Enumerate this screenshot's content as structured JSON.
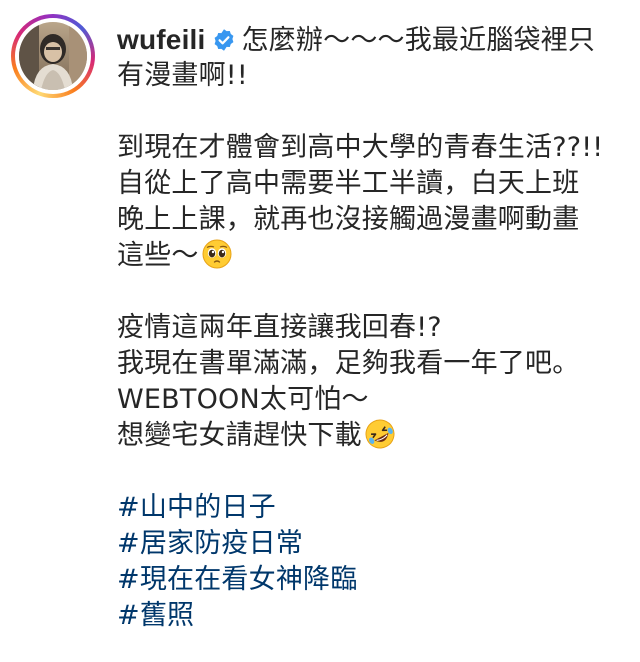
{
  "post": {
    "username": "wufeili",
    "verified_icon": "verified-badge-icon",
    "caption_lines": [
      "怎麼辦～～～我最近腦袋裡只",
      "有漫畫啊!!",
      "",
      "到現在才體會到高中大學的青春生活??!!",
      "自從上了高中需要半工半讀，白天上班",
      "晚上上課，就再也沒接觸過漫畫啊動畫",
      "這些～",
      "",
      "疫情這兩年直接讓我回春!?",
      "我現在書單滿滿，足夠我看一年了吧。",
      "WEBTOON太可怕～",
      "想變宅女請趕快下載",
      ""
    ],
    "emojis": {
      "pleading": "pleading-face-icon",
      "rofl": "rolling-on-floor-laughing-icon"
    },
    "hashtags": [
      "#山中的日子",
      "#居家防疫日常",
      "#現在在看女神降臨",
      "#舊照"
    ]
  },
  "colors": {
    "text": "#262626",
    "hashtag": "#00376b",
    "verified": "#3897f0",
    "ring_start": "#feda75",
    "ring_mid": "#d62976",
    "ring_end": "#4f5bd5"
  }
}
